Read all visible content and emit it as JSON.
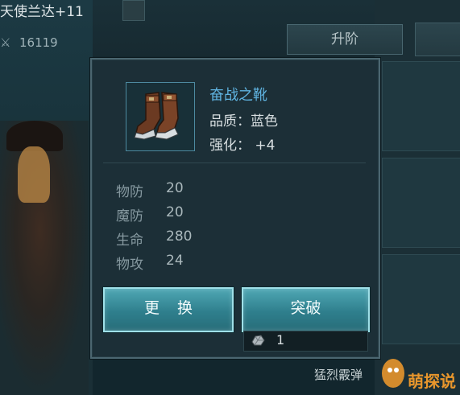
{
  "background": {
    "hero_name": "天使兰达+11",
    "power_value": "16119",
    "upgrade_label": "升阶",
    "skill_label": "猛烈霰弹"
  },
  "item": {
    "name": "奋战之靴",
    "quality": "品质：蓝色",
    "enhance": "强化：  +4",
    "icon": "boots-icon"
  },
  "stats": [
    {
      "label": "物防",
      "value": "20"
    },
    {
      "label": "魔防",
      "value": "20"
    },
    {
      "label": "生命",
      "value": "280"
    },
    {
      "label": "物攻",
      "value": "24"
    }
  ],
  "actions": {
    "replace_label": "更换",
    "breakthrough_label": "突破"
  },
  "cost": {
    "icon": "ore-icon",
    "amount": "1"
  },
  "watermark": {
    "text": "萌探说"
  },
  "colors": {
    "item_name": "#5fb3e0",
    "button": "#3a909e",
    "watermark": "#e8962c"
  }
}
